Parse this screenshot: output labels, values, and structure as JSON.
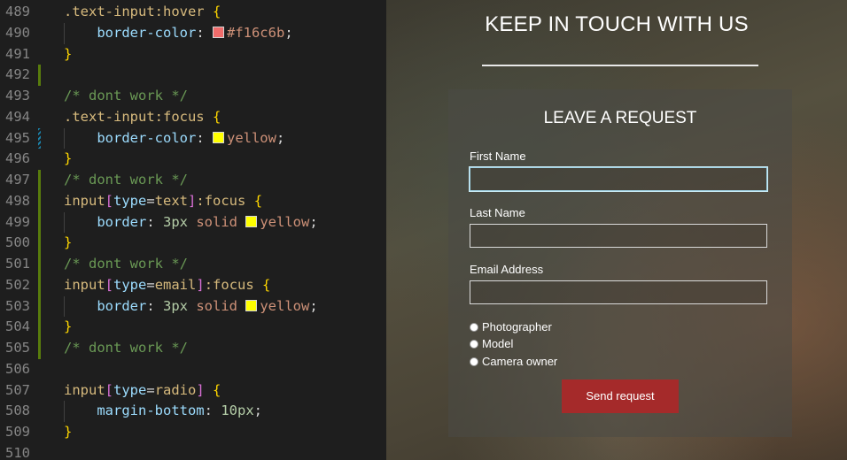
{
  "editor": {
    "lines": [
      {
        "num": "489",
        "gutter": "none",
        "guide": false,
        "tokens": [
          [
            "sel",
            ".text-input:hover "
          ],
          [
            "br",
            "{"
          ]
        ]
      },
      {
        "num": "490",
        "gutter": "none",
        "guide": true,
        "tokens": [
          [
            "pad",
            "    "
          ],
          [
            "prop",
            "border-color"
          ],
          [
            "punc",
            ": "
          ],
          [
            "swatch",
            "#f16c6b"
          ],
          [
            "val",
            "#f16c6b"
          ],
          [
            "punc",
            ";"
          ]
        ]
      },
      {
        "num": "491",
        "gutter": "none",
        "guide": false,
        "tokens": [
          [
            "br",
            "}"
          ]
        ]
      },
      {
        "num": "492",
        "gutter": "added",
        "guide": false,
        "tokens": []
      },
      {
        "num": "493",
        "gutter": "none",
        "guide": false,
        "tokens": [
          [
            "com",
            "/* dont work */"
          ]
        ]
      },
      {
        "num": "494",
        "gutter": "none",
        "guide": false,
        "tokens": [
          [
            "sel",
            ".text-input:focus "
          ],
          [
            "br",
            "{"
          ]
        ]
      },
      {
        "num": "495",
        "gutter": "mod",
        "guide": true,
        "tokens": [
          [
            "pad",
            "    "
          ],
          [
            "prop",
            "border-color"
          ],
          [
            "punc",
            ": "
          ],
          [
            "swatch",
            "#ffff00"
          ],
          [
            "val",
            "yellow"
          ],
          [
            "punc",
            ";"
          ]
        ]
      },
      {
        "num": "496",
        "gutter": "none",
        "guide": false,
        "tokens": [
          [
            "br",
            "}"
          ]
        ]
      },
      {
        "num": "497",
        "gutter": "added",
        "guide": false,
        "tokens": [
          [
            "com",
            "/* dont work */"
          ]
        ]
      },
      {
        "num": "498",
        "gutter": "added",
        "guide": false,
        "tokens": [
          [
            "sel",
            "input"
          ],
          [
            "brk",
            "["
          ],
          [
            "att",
            "type"
          ],
          [
            "punc",
            "="
          ],
          [
            "sel",
            "text"
          ],
          [
            "brk",
            "]"
          ],
          [
            "sel",
            ":focus "
          ],
          [
            "br",
            "{"
          ]
        ]
      },
      {
        "num": "499",
        "gutter": "added",
        "guide": true,
        "tokens": [
          [
            "pad",
            "    "
          ],
          [
            "prop",
            "border"
          ],
          [
            "punc",
            ": "
          ],
          [
            "num",
            "3px"
          ],
          [
            "val",
            " solid "
          ],
          [
            "swatch",
            "#ffff00"
          ],
          [
            "val",
            "yellow"
          ],
          [
            "punc",
            ";"
          ]
        ]
      },
      {
        "num": "500",
        "gutter": "added",
        "guide": false,
        "tokens": [
          [
            "br",
            "}"
          ]
        ]
      },
      {
        "num": "501",
        "gutter": "added",
        "guide": false,
        "tokens": [
          [
            "com",
            "/* dont work */"
          ]
        ]
      },
      {
        "num": "502",
        "gutter": "added",
        "guide": false,
        "tokens": [
          [
            "sel",
            "input"
          ],
          [
            "brk",
            "["
          ],
          [
            "att",
            "type"
          ],
          [
            "punc",
            "="
          ],
          [
            "sel",
            "email"
          ],
          [
            "brk",
            "]"
          ],
          [
            "sel",
            ":focus "
          ],
          [
            "br",
            "{"
          ]
        ]
      },
      {
        "num": "503",
        "gutter": "added",
        "guide": true,
        "tokens": [
          [
            "pad",
            "    "
          ],
          [
            "prop",
            "border"
          ],
          [
            "punc",
            ": "
          ],
          [
            "num",
            "3px"
          ],
          [
            "val",
            " solid "
          ],
          [
            "swatch",
            "#ffff00"
          ],
          [
            "val",
            "yellow"
          ],
          [
            "punc",
            ";"
          ]
        ]
      },
      {
        "num": "504",
        "gutter": "added",
        "guide": false,
        "tokens": [
          [
            "br",
            "}"
          ]
        ]
      },
      {
        "num": "505",
        "gutter": "added",
        "guide": false,
        "tokens": [
          [
            "com",
            "/* dont work */"
          ]
        ]
      },
      {
        "num": "506",
        "gutter": "none",
        "guide": false,
        "tokens": []
      },
      {
        "num": "507",
        "gutter": "none",
        "guide": false,
        "tokens": [
          [
            "sel",
            "input"
          ],
          [
            "brk",
            "["
          ],
          [
            "att",
            "type"
          ],
          [
            "punc",
            "="
          ],
          [
            "sel",
            "radio"
          ],
          [
            "brk",
            "]"
          ],
          [
            "sel",
            " "
          ],
          [
            "br",
            "{"
          ]
        ]
      },
      {
        "num": "508",
        "gutter": "none",
        "guide": true,
        "tokens": [
          [
            "pad",
            "    "
          ],
          [
            "prop",
            "margin-bottom"
          ],
          [
            "punc",
            ": "
          ],
          [
            "num",
            "10px"
          ],
          [
            "punc",
            ";"
          ]
        ]
      },
      {
        "num": "509",
        "gutter": "none",
        "guide": false,
        "tokens": [
          [
            "br",
            "}"
          ]
        ]
      },
      {
        "num": "510",
        "gutter": "none",
        "guide": false,
        "tokens": []
      }
    ]
  },
  "page": {
    "heading": "KEEP IN TOUCH WITH US",
    "form": {
      "title": "LEAVE A REQUEST",
      "first_name_label": "First Name",
      "first_name_value": "",
      "last_name_label": "Last Name",
      "last_name_value": "",
      "email_label": "Email Address",
      "email_value": "",
      "radio_options": [
        "Photographer",
        "Model",
        "Camera owner"
      ],
      "submit_label": "Send request"
    },
    "colors": {
      "button": "#a52a2a",
      "focus_ring": "#9fd3e6"
    }
  }
}
